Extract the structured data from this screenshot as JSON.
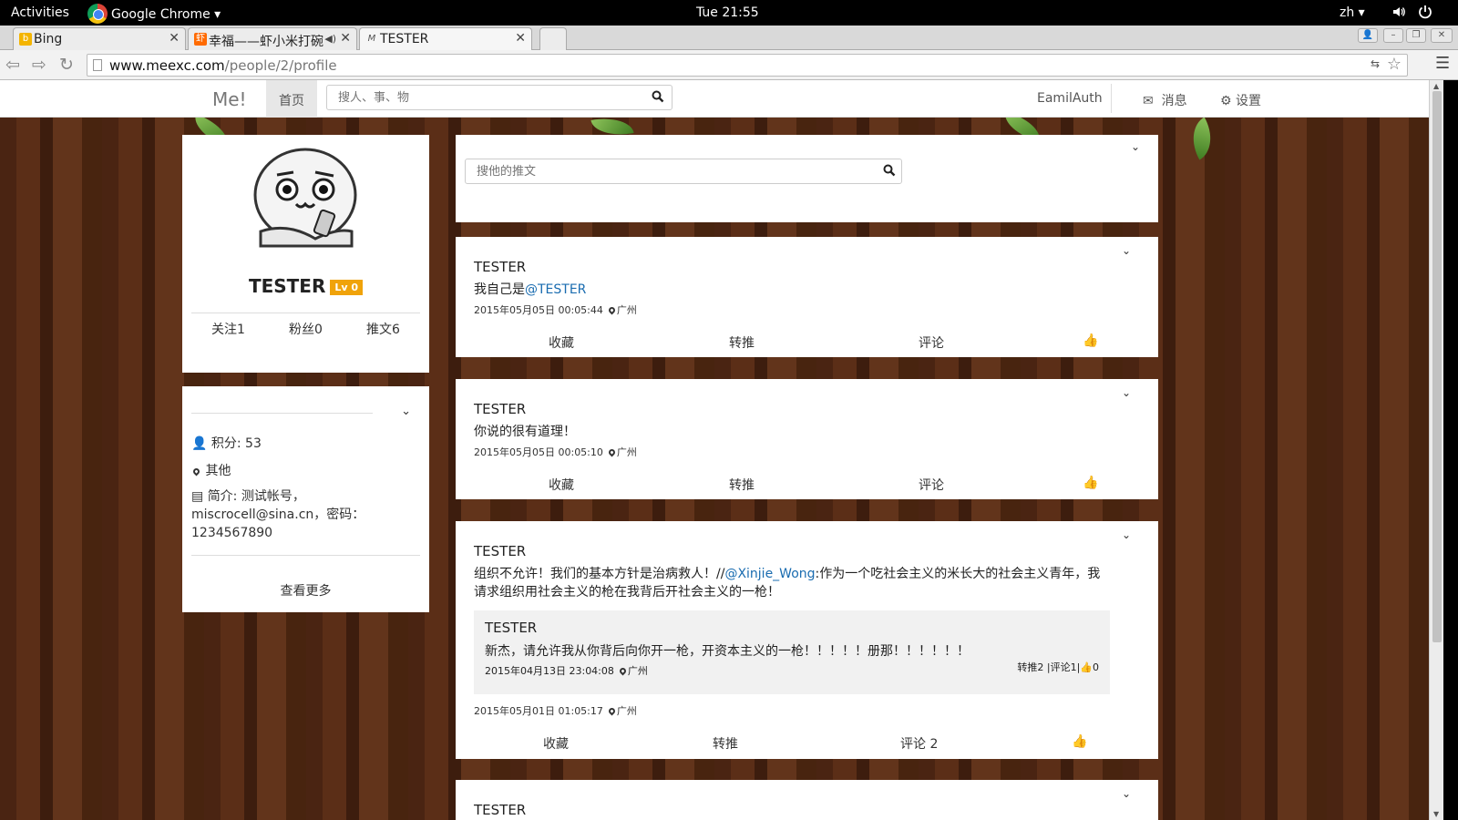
{
  "os_bar": {
    "activities": "Activities",
    "app_name": "Google Chrome ▾",
    "clock": "Tue 21:55",
    "lang": "zh ▾",
    "volume_icon": "speaker-icon",
    "power_icon": "power-icon"
  },
  "browser": {
    "tabs": [
      {
        "title": "Bing",
        "favicon": "bing-icon",
        "fav_color": "#f4b400",
        "fav_char": "b"
      },
      {
        "title": "幸福——虾小米打碗",
        "favicon": "xiami-icon",
        "fav_color": "#ff6a00",
        "fav_char": "虾"
      },
      {
        "title": "TESTER",
        "favicon": "me-icon",
        "fav_color": "#777777",
        "fav_char": "M"
      }
    ],
    "url_host": "www.meexc.com",
    "url_path": "/people/2/profile"
  },
  "site": {
    "brand": "Me!",
    "home": "首页",
    "search_placeholder": "搜人、事、物",
    "account": "EamilAuth",
    "messages": "消息",
    "settings": "设置",
    "accent": "#1a6cb0"
  },
  "profile": {
    "name": "TESTER",
    "level": "Lv 0",
    "following": "关注1",
    "followers": "粉丝0",
    "tweets": "推文6"
  },
  "info": {
    "points": "积分: 53",
    "location": "其他",
    "bio_line1": "简介:  测试帐号，",
    "bio_line2": "miscrocell@sina.cn，密码：",
    "bio_line3": "1234567890",
    "more": "查看更多"
  },
  "feed": {
    "search_placeholder": "搜他的推文",
    "action_fav": "收藏",
    "action_rt": "转推",
    "action_comment": "评论",
    "tweets": [
      {
        "author": "TESTER",
        "text_pre": "我自己是",
        "mention": "@TESTER",
        "time": "2015年05月05日 00:05:44",
        "place": "广州"
      },
      {
        "author": "TESTER",
        "text": "你说的很有道理！",
        "time": "2015年05月05日 00:05:10",
        "place": "广州"
      },
      {
        "author": "TESTER",
        "text_pre": "组织不允许！我们的基本方针是治病救人！//",
        "mention": "@Xinjie_Wong",
        "text_post": ":作为一个吃社会主义的米长大的社会主义青年，我请求组织用社会主义的枪在我背后开社会主义的一枪！",
        "quote": {
          "author": "TESTER",
          "text": "新杰，请允许我从你背后向你开一枪，开资本主义的一枪！！！！！册那！！！！！！",
          "time": "2015年04月13日 23:04:08",
          "place": "广州",
          "stats": "转推2 |评论1|",
          " likes": "0"
        },
        "time": "2015年05月01日 01:05:17",
        "place": "广州",
        "comment_label": "评论 2"
      },
      {
        "author": "TESTER"
      }
    ]
  }
}
